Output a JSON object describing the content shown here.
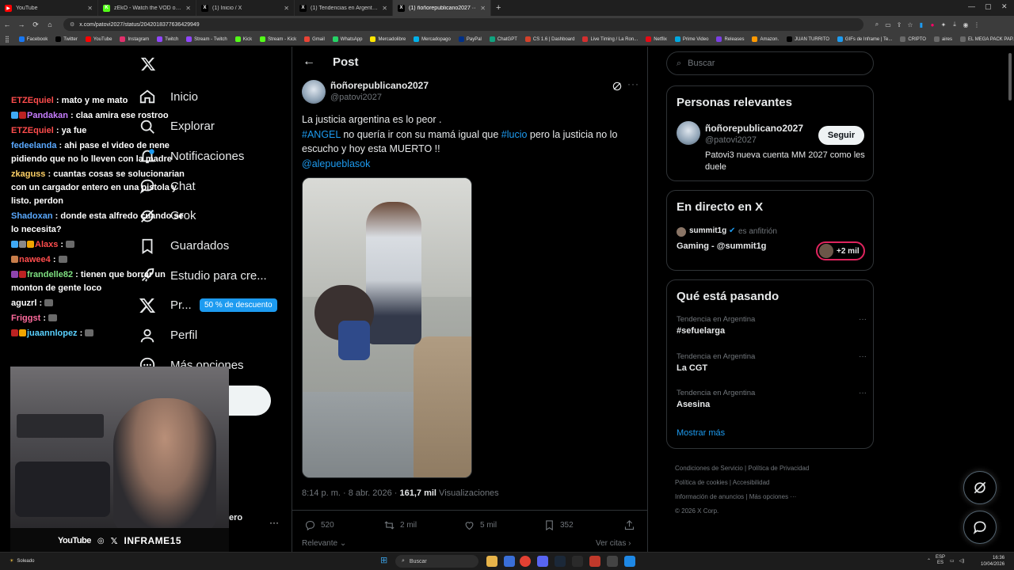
{
  "browser": {
    "tabs": [
      {
        "title": "YouTube",
        "color": "#ff0000",
        "glyph": "▶",
        "active": false
      },
      {
        "title": "zEkO - Watch the VOD on Kick",
        "color": "#53fc18",
        "glyph": "K",
        "active": false
      },
      {
        "title": "(1) Inicio / X",
        "color": "#000000",
        "glyph": "X",
        "active": false
      },
      {
        "title": "(1) Tendencias en Argentina (E",
        "color": "#000000",
        "glyph": "X",
        "active": false
      },
      {
        "title": "(1) ñoñorepublicano2027 ··",
        "color": "#000000",
        "glyph": "X",
        "active": true
      }
    ],
    "new_tab": "+",
    "url": "x.com/patovi2027/status/2042018377636429949",
    "bookmarks": [
      {
        "label": "Facebook",
        "color": "#1877f2"
      },
      {
        "label": "Twitter",
        "color": "#000000"
      },
      {
        "label": "YouTube",
        "color": "#ff0000"
      },
      {
        "label": "Instagram",
        "color": "#e1306c"
      },
      {
        "label": "Twitch",
        "color": "#9146ff"
      },
      {
        "label": "Stream - Twitch",
        "color": "#9146ff"
      },
      {
        "label": "Kick",
        "color": "#53fc18"
      },
      {
        "label": "Stream - Kick",
        "color": "#53fc18"
      },
      {
        "label": "Gmail",
        "color": "#ea4335"
      },
      {
        "label": "WhatsApp",
        "color": "#25d366"
      },
      {
        "label": "Mercadolibre",
        "color": "#ffe600"
      },
      {
        "label": "Mercadopago",
        "color": "#00b1ea"
      },
      {
        "label": "PayPal",
        "color": "#003087"
      },
      {
        "label": "ChatGPT",
        "color": "#10a37f"
      },
      {
        "label": "CS 1.6 | Dashboard",
        "color": "#d4412a"
      },
      {
        "label": "Live Timing / La Ron...",
        "color": "#d32f2f"
      },
      {
        "label": "Netflix",
        "color": "#e50914"
      },
      {
        "label": "Prime Video",
        "color": "#00a8e1"
      },
      {
        "label": "Releases",
        "color": "#7b3fe4"
      },
      {
        "label": "Amazon.",
        "color": "#ff9900"
      },
      {
        "label": "JUAN TURRITO",
        "color": "#000000"
      },
      {
        "label": "GIFs de Inframe | Te...",
        "color": "#1d9bf0"
      },
      {
        "label": "CRIPTO",
        "color": "#6a6a6a"
      },
      {
        "label": "aires",
        "color": "#6a6a6a"
      },
      {
        "label": "EL MEGA PACK PAP...",
        "color": "#6a6a6a"
      }
    ]
  },
  "nav": {
    "items": [
      {
        "label": "Inicio",
        "icon": "home-icon"
      },
      {
        "label": "Explorar",
        "icon": "search-icon"
      },
      {
        "label": "Notificaciones",
        "icon": "bell-icon"
      },
      {
        "label": "Chat",
        "icon": "chat-icon"
      },
      {
        "label": "Grok",
        "icon": "grok-icon"
      },
      {
        "label": "Guardados",
        "icon": "bookmark-icon"
      },
      {
        "label": "Estudio para cre...",
        "icon": "rocket-icon"
      },
      {
        "label": "Pr...",
        "icon": "x-logo-icon"
      },
      {
        "label": "Perfil",
        "icon": "user-icon"
      },
      {
        "label": "Más opciones",
        "icon": "more-circle-icon"
      }
    ],
    "premium_badge": "50 % de descuento",
    "bottom_fragment": "ero",
    "bottom_dots": "···"
  },
  "chat": {
    "messages": [
      {
        "user": "ETZEquiel",
        "color": "#ff4d4d",
        "text": ": mato y me mato",
        "badges": []
      },
      {
        "user": "Pandakan",
        "color": "#c77dff",
        "text": ": claa amira ese rostroo",
        "badges": [
          "#3fa9f5",
          "#b22"
        ]
      },
      {
        "user": "ETZEquiel",
        "color": "#ff4d4d",
        "text": ": ya fue",
        "badges": []
      },
      {
        "user": "fedeelanda",
        "color": "#5aa9ff",
        "text": ": ahi pase el video de nene pidiendo que no lo lleven con la madre",
        "badges": []
      },
      {
        "user": "zkaguss",
        "color": "#ffd166",
        "text": ": cuantas cosas se solucionarian con un cargador entero en una pistola y listo. perdon",
        "badges": []
      },
      {
        "user": "Shadoxan",
        "color": "#5aa9ff",
        "text": ": donde esta alfredo cuando se lo necesita?",
        "badges": []
      },
      {
        "user": "Alaxs",
        "color": "#ff4d4d",
        "text": ":",
        "badges": [
          "#3fa9f5",
          "#888",
          "#f0a500"
        ],
        "emote": true
      },
      {
        "user": "nawee4",
        "color": "#ff4d4d",
        "text": ":",
        "badges": [
          "#c77d4a"
        ],
        "emote": true
      },
      {
        "user": "frandelle82",
        "color": "#7ee081",
        "text": ": tienen que borrar un monton de gente loco",
        "badges": [
          "#8e44ad",
          "#b22"
        ]
      },
      {
        "user": "aguzrl",
        "color": "#ffffff",
        "text": ":",
        "badges": [],
        "emote": true
      },
      {
        "user": "Friggst",
        "color": "#ff6b9d",
        "text": ":",
        "badges": [],
        "emote": true
      },
      {
        "user": "juaannlopez",
        "color": "#5ad1ff",
        "text": ":",
        "badges": [
          "#b22",
          "#f0a500"
        ],
        "emote": true
      }
    ]
  },
  "webcam": {
    "socials": "YouTube",
    "handle": "INFRAME15"
  },
  "post": {
    "header_title": "Post",
    "author_name": "ñoñorepublicano2027",
    "author_handle": "@patovi2027",
    "text_line1": "La justicia argentina es lo peor .",
    "hashtag1": "#ANGEL",
    "text_mid": " no quería ir con su mamá igual que ",
    "hashtag2": "#lucio",
    "text_end": " pero la justicia no lo escucho y hoy esta MUERTO !!",
    "mention": "@alepueblasok",
    "time": "8:14 p. m. · 8 abr. 2026 · ",
    "views_count": "161,7 mil",
    "views_label": " Visualizaciones",
    "replies": "520",
    "reposts": "2 mil",
    "likes": "5 mil",
    "bookmarks": "352",
    "sort": "Relevante",
    "quotes": "Ver citas"
  },
  "sidebar": {
    "search_placeholder": "Buscar",
    "relevant_title": "Personas relevantes",
    "relevant_name": "ñoñorepublicano2027",
    "relevant_handle": "@patovi2027",
    "relevant_bio": "Patovi3 nueva cuenta MM 2027 como les duele",
    "follow": "Seguir",
    "live_title": "En directo en X",
    "live_user": "summit1g",
    "live_role": "es anfitrión",
    "live_stream": "Gaming - @summit1g",
    "live_count": "+2 mil",
    "trends_title": "Qué está pasando",
    "trends": [
      {
        "context": "Tendencia en Argentina",
        "name": "#sefuelarga"
      },
      {
        "context": "Tendencia en Argentina",
        "name": "La CGT"
      },
      {
        "context": "Tendencia en Argentina",
        "name": "Asesina"
      }
    ],
    "show_more": "Mostrar más",
    "footer": [
      "Condiciones de Servicio",
      "Política de Privacidad",
      "Política de cookies",
      "Accesibilidad",
      "Información de anuncios",
      "Más opciones ···",
      "© 2026 X Corp."
    ]
  },
  "taskbar": {
    "weather": "Soleado",
    "search": "Buscar",
    "lang": "ESP",
    "lang2": "ES",
    "time": "16:36",
    "date": "10/04/2026"
  }
}
